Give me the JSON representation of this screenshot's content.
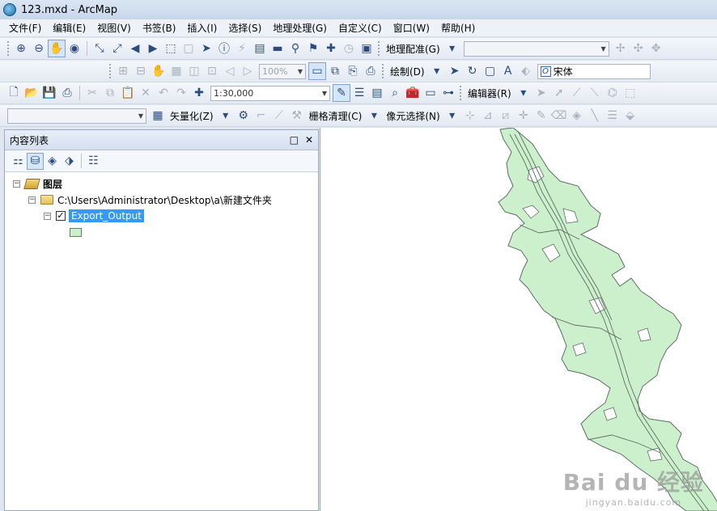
{
  "window": {
    "title": "123.mxd - ArcMap"
  },
  "menu": [
    "文件(F)",
    "编辑(E)",
    "视图(V)",
    "书签(B)",
    "插入(I)",
    "选择(S)",
    "地理处理(G)",
    "自定义(C)",
    "窗口(W)",
    "帮助(H)"
  ],
  "toolbar": {
    "georef_label": "地理配准(G)",
    "zoom_percent": "100%",
    "draw_label": "绘制(D)",
    "font_name": "宋体",
    "scale": "1:30,000",
    "editor_label": "编辑器(R)",
    "vectorize_label": "矢量化(Z)",
    "raster_cleanup_label": "栅格清理(C)",
    "pixel_select_label": "像元选择(N)"
  },
  "toc": {
    "title": "内容列表",
    "root_label": "图层",
    "folder_path": "C:\\Users\\Administrator\\Desktop\\a\\新建文件夹",
    "layer_name": "Export_Output",
    "layer_color": "#cceecc"
  },
  "map": {
    "fill_color": "#ccf0cc",
    "line_color": "#5f6f66"
  },
  "watermark": {
    "main": "Bai du 经验",
    "sub": "jingyan.baidu.com"
  }
}
